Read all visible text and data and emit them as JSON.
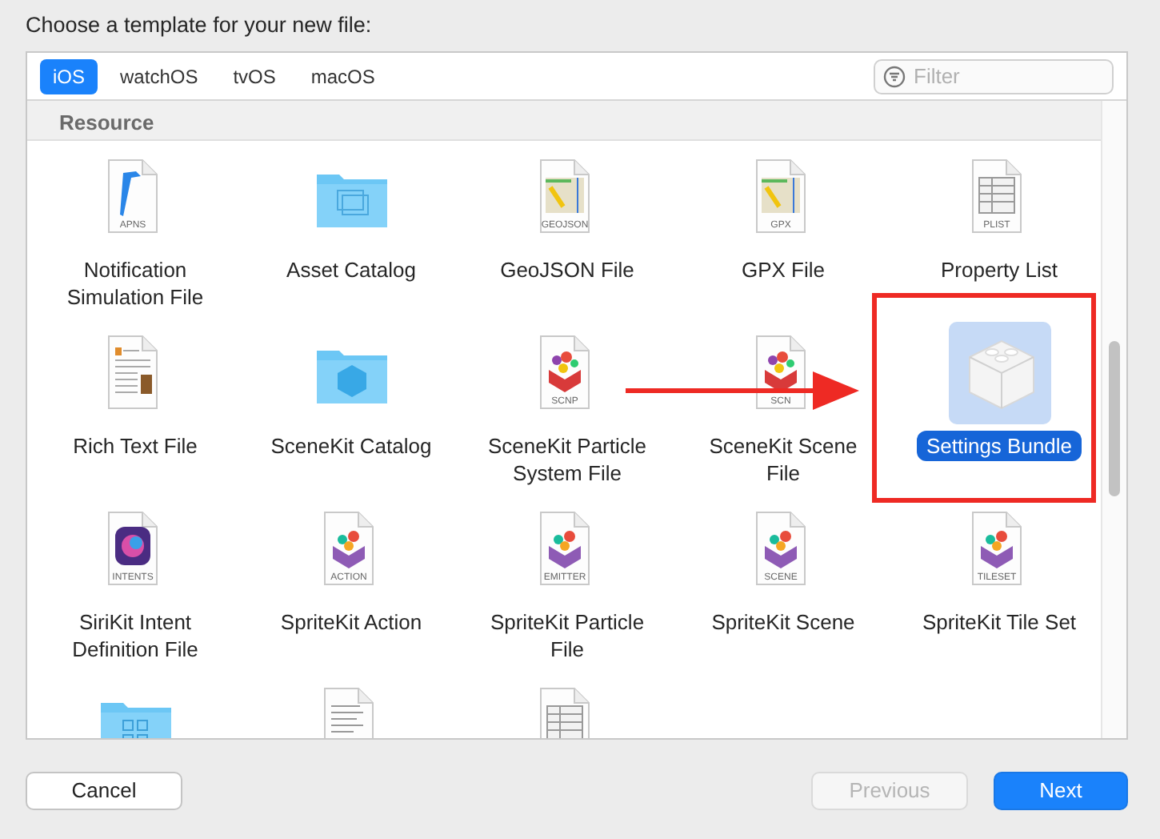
{
  "prompt": "Choose a template for your new file:",
  "tabs": [
    {
      "label": "iOS",
      "selected": true
    },
    {
      "label": "watchOS",
      "selected": false
    },
    {
      "label": "tvOS",
      "selected": false
    },
    {
      "label": "macOS",
      "selected": false
    }
  ],
  "filter": {
    "placeholder": "Filter"
  },
  "section": "Resource",
  "templates": [
    {
      "kind": "apns",
      "badge": "APNS",
      "label": "Notification Simulation File",
      "selected": false
    },
    {
      "kind": "folder-layers",
      "label": "Asset Catalog",
      "selected": false
    },
    {
      "kind": "map",
      "badge": "GEOJSON",
      "label": "GeoJSON File",
      "selected": false
    },
    {
      "kind": "map",
      "badge": "GPX",
      "label": "GPX File",
      "selected": false
    },
    {
      "kind": "plist",
      "badge": "PLIST",
      "label": "Property List",
      "selected": false
    },
    {
      "kind": "richtext",
      "label": "Rich Text File",
      "selected": false
    },
    {
      "kind": "folder-cube",
      "label": "SceneKit Catalog",
      "selected": false
    },
    {
      "kind": "scenekit",
      "badge": "SCNP",
      "label": "SceneKit Particle System File",
      "selected": false
    },
    {
      "kind": "scenekit",
      "badge": "SCN",
      "label": "SceneKit Scene File",
      "selected": false
    },
    {
      "kind": "bundle",
      "label": "Settings Bundle",
      "selected": true
    },
    {
      "kind": "intents",
      "badge": "INTENTS",
      "label": "SiriKit Intent Definition File",
      "selected": false
    },
    {
      "kind": "sprite",
      "badge": "ACTION",
      "label": "SpriteKit Action",
      "selected": false
    },
    {
      "kind": "sprite",
      "badge": "EMITTER",
      "label": "SpriteKit Particle File",
      "selected": false
    },
    {
      "kind": "sprite",
      "badge": "SCENE",
      "label": "SpriteKit Scene",
      "selected": false
    },
    {
      "kind": "sprite",
      "badge": "TILESET",
      "label": "SpriteKit Tile Set",
      "selected": false
    },
    {
      "kind": "folder-grid",
      "selected": false
    },
    {
      "kind": "doctext",
      "selected": false
    },
    {
      "kind": "plist",
      "selected": false
    }
  ],
  "annotation": {
    "arrow": true,
    "highlight_box": true
  },
  "buttons": [
    {
      "kind": "cancel",
      "label": "Cancel",
      "disabled": false
    },
    {
      "kind": "previous",
      "label": "Previous",
      "disabled": true
    },
    {
      "kind": "next",
      "label": "Next",
      "disabled": false
    }
  ]
}
